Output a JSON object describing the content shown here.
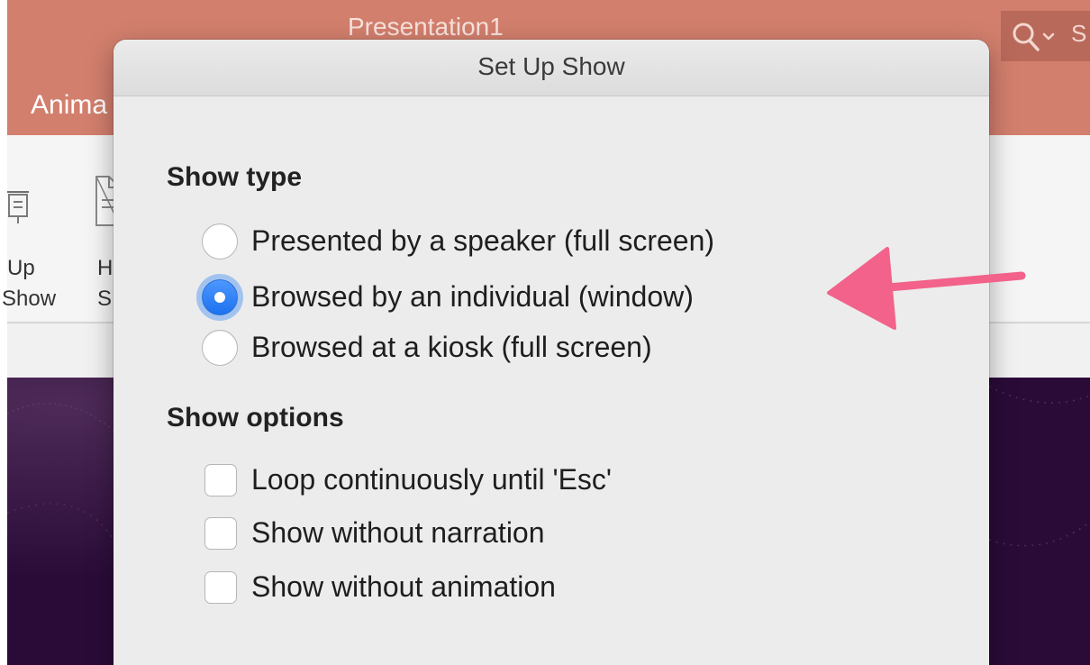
{
  "app": {
    "document_title": "Presentation1",
    "active_tab_partial": "Anima",
    "search_partial": "S",
    "ribbon_buttons": [
      {
        "line1": "Up",
        "line2": "Show"
      },
      {
        "line1": "H",
        "line2": "S"
      }
    ]
  },
  "dialog": {
    "title": "Set Up Show",
    "show_type": {
      "heading": "Show type",
      "options": [
        {
          "label": "Presented by a speaker (full screen)",
          "selected": false
        },
        {
          "label": "Browsed by an individual (window)",
          "selected": true
        },
        {
          "label": "Browsed at a kiosk (full screen)",
          "selected": false
        }
      ]
    },
    "show_options": {
      "heading": "Show options",
      "options": [
        {
          "label": "Loop continuously until 'Esc'",
          "checked": false
        },
        {
          "label": "Show without narration",
          "checked": false
        },
        {
          "label": "Show without animation",
          "checked": false
        }
      ]
    }
  },
  "colors": {
    "titlebar": "#d37f6d",
    "accent_blue": "#1c72ee",
    "annotation_arrow": "#f2628a",
    "slide_background": "#2c0c3a"
  },
  "icons": [
    "search-icon",
    "chevron-down-icon",
    "set-up-show-icon",
    "hide-slide-icon"
  ]
}
